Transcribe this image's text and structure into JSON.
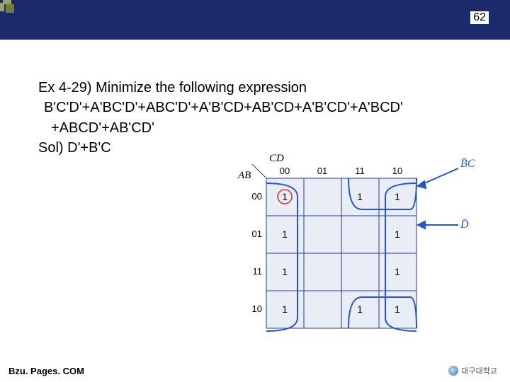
{
  "slide": {
    "number": "62",
    "footer": "Bzu. Pages. COM",
    "logo_text": "대구대학교"
  },
  "content": {
    "title_line": "Ex 4-29) Minimize the following expression",
    "expr_line1": "B'C'D'+A'BC'D'+ABC'D'+A'B'CD+AB'CD+A'B'CD'+A'BCD'",
    "expr_line2": "+ABCD'+AB'CD'",
    "solution": "Sol) D'+B'C"
  },
  "kmap": {
    "row_label": "AB",
    "col_label": "CD",
    "col_headers": [
      "00",
      "01",
      "11",
      "10"
    ],
    "row_headers": [
      "00",
      "01",
      "11",
      "10"
    ],
    "cells": [
      [
        "1",
        "",
        "1",
        "1"
      ],
      [
        "1",
        "",
        "",
        "1"
      ],
      [
        "1",
        "",
        "",
        "1"
      ],
      [
        "1",
        "",
        "1",
        "1"
      ]
    ],
    "annotation_top": "B̄C",
    "annotation_right": "D̄"
  },
  "chart_data": {
    "type": "table",
    "description": "4-variable Karnaugh map (AB rows, CD columns) with minterm 1s marked",
    "columns_CD": [
      "00",
      "01",
      "11",
      "10"
    ],
    "rows_AB": [
      "00",
      "01",
      "11",
      "10"
    ],
    "grid_values": [
      [
        1,
        0,
        1,
        1
      ],
      [
        1,
        0,
        0,
        1
      ],
      [
        1,
        0,
        0,
        1
      ],
      [
        1,
        0,
        1,
        1
      ]
    ],
    "groups": [
      {
        "name": "D'",
        "cells": [
          [
            0,
            0
          ],
          [
            1,
            0
          ],
          [
            2,
            0
          ],
          [
            3,
            0
          ],
          [
            0,
            3
          ],
          [
            1,
            3
          ],
          [
            2,
            3
          ],
          [
            3,
            3
          ]
        ]
      },
      {
        "name": "B'C",
        "cells": [
          [
            0,
            2
          ],
          [
            0,
            3
          ],
          [
            3,
            2
          ],
          [
            3,
            3
          ]
        ]
      }
    ],
    "result": "D' + B'C"
  }
}
